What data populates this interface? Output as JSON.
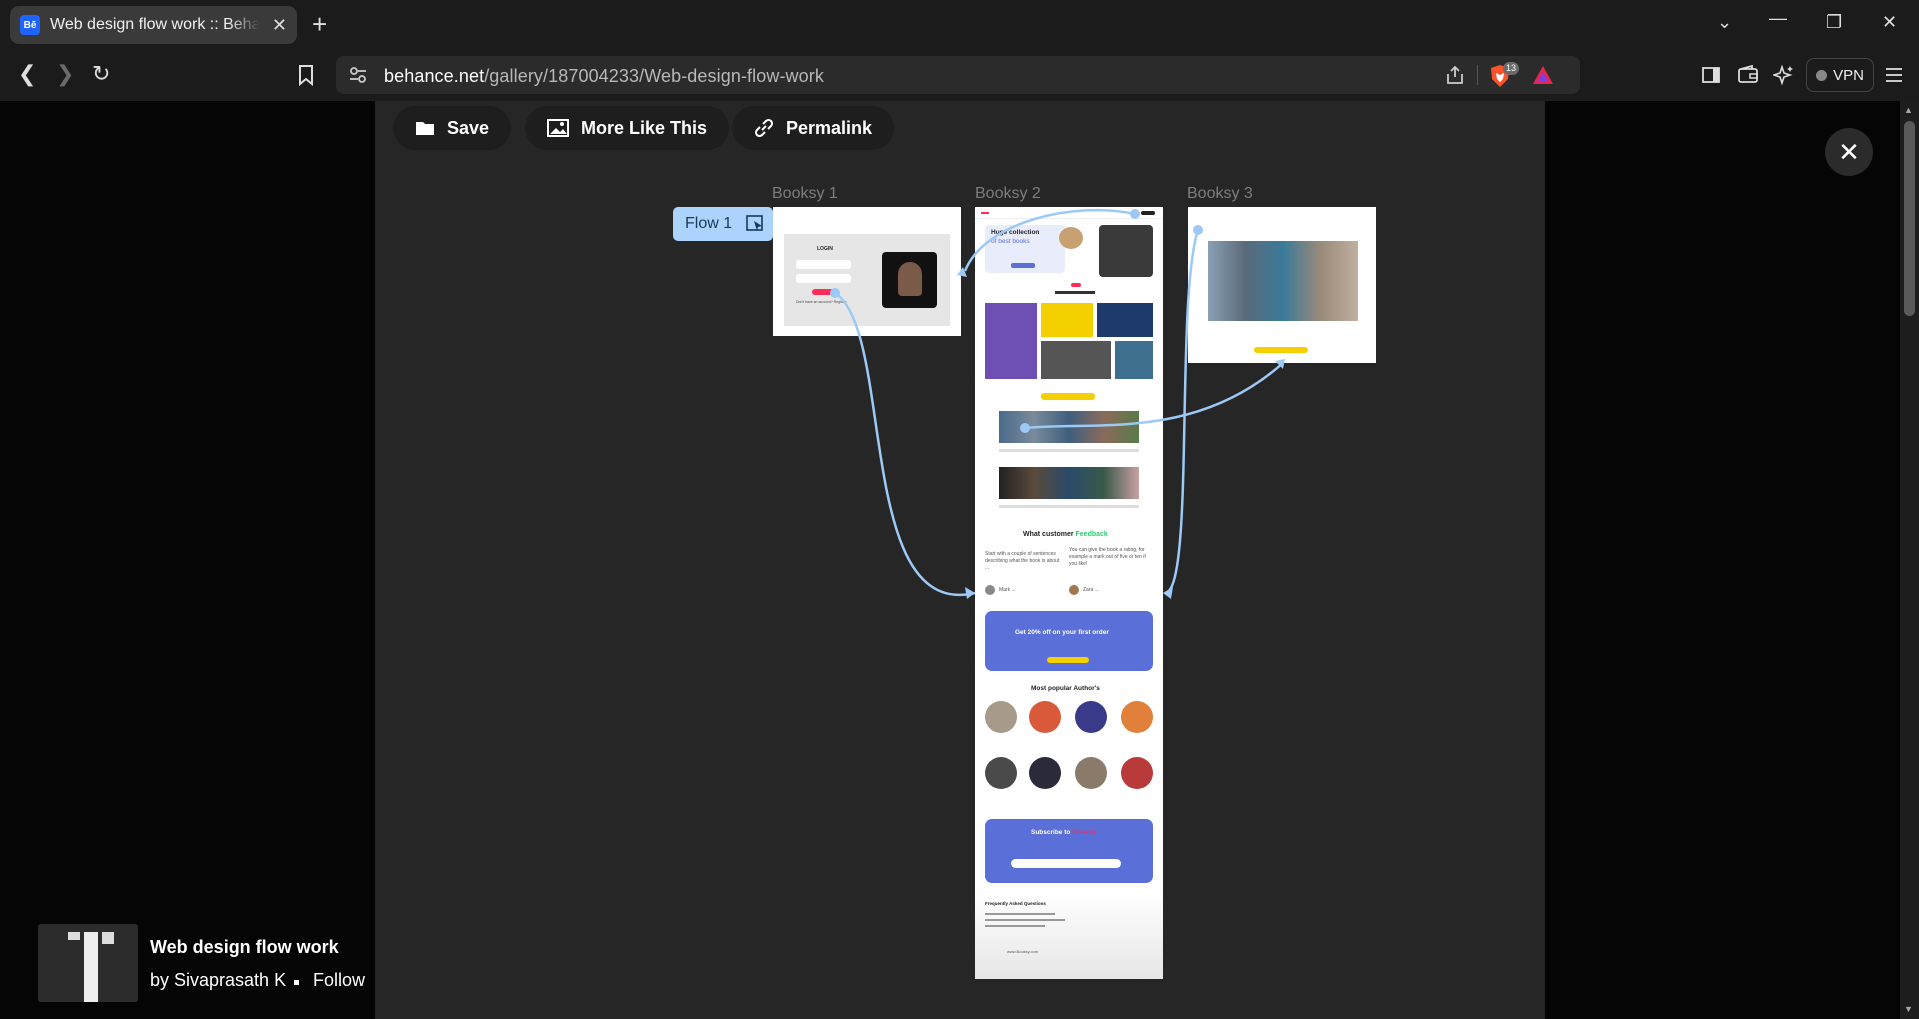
{
  "browser": {
    "tab_title": "Web design flow work :: Behance",
    "tab_favicon": "Bē",
    "url_host": "behance.net",
    "url_path": "/gallery/187004233/Web-design-flow-work",
    "brave_shield_count": "13",
    "vpn_label": "VPN",
    "icons": [
      "back-icon",
      "forward-icon",
      "reload-icon",
      "bookmark-icon",
      "share-icon",
      "brave-shield-icon",
      "brave-rewards-icon",
      "sidebar-icon",
      "wallet-icon",
      "leo-ai-icon",
      "menu-icon"
    ]
  },
  "viewer": {
    "actions": [
      {
        "label": "Save",
        "icon": "folder-icon"
      },
      {
        "label": "More Like This",
        "icon": "image-icon"
      },
      {
        "label": "Permalink",
        "icon": "link-icon"
      }
    ],
    "close_icon": "close-icon"
  },
  "prototype": {
    "flow_label": "Flow 1",
    "frames": [
      {
        "name": "Booksy 1"
      },
      {
        "name": "Booksy 2"
      },
      {
        "name": "Booksy 3"
      }
    ],
    "login_frame": {
      "heading": "LOGIN",
      "footer": "Don't have an account? Register"
    },
    "home_frame": {
      "hero_title": "Huge collection",
      "hero_accent": "of best books",
      "feedback_title": "What customer",
      "feedback_accent": "Feedback",
      "feedback_left": "Start with a couple of sentences describing what the book is about ...",
      "feedback_right": "You can give the book a rating, for example a mark out of five or ten if you like!",
      "reviewer_left": "Mark ... ",
      "reviewer_right": "Zara ...",
      "offer_title": "Get 20% off on your first order",
      "offer_button": "Shop now",
      "authors_title": "Most popular Author's",
      "subscribe_title": "Subscribe to",
      "subscribe_accent": "Booksy",
      "faq_title": "Frequently Asked Questions",
      "footer_site": "www.Booksy.com"
    },
    "colors": {
      "accent_yellow": "#f5d000",
      "accent_pink": "#ff2d55",
      "accent_blue": "#5b6fd8",
      "flow_line": "#9cc9f5",
      "feedback_green": "#2ecc71"
    }
  },
  "project": {
    "title": "Web design flow work",
    "author": "by Sivaprasath K",
    "follow_label": "Follow"
  }
}
